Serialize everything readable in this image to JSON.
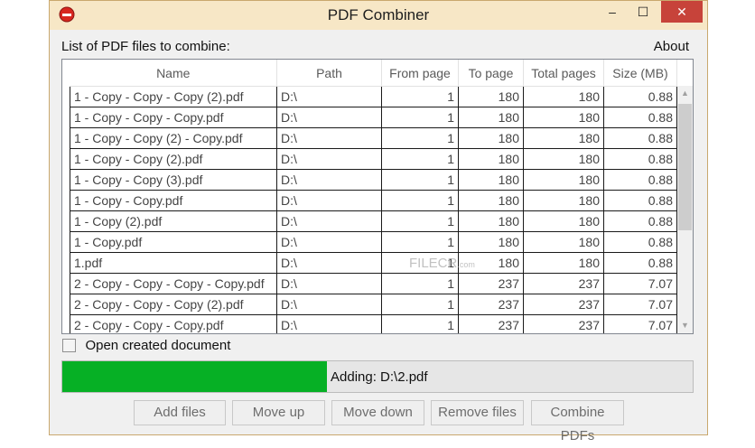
{
  "window": {
    "title": "PDF Combiner",
    "controls": {
      "minimize": "–",
      "maximize": "☐",
      "close": "✕"
    }
  },
  "list_label": "List of PDF files to combine:",
  "about_label": "About",
  "table": {
    "columns": [
      "Name",
      "Path",
      "From page",
      "To page",
      "Total pages",
      "Size (MB)"
    ],
    "rows": [
      [
        "1 - Copy - Copy - Copy (2).pdf",
        "D:\\",
        "1",
        "180",
        "180",
        "0.88"
      ],
      [
        "1 - Copy - Copy - Copy.pdf",
        "D:\\",
        "1",
        "180",
        "180",
        "0.88"
      ],
      [
        "1 - Copy - Copy (2) - Copy.pdf",
        "D:\\",
        "1",
        "180",
        "180",
        "0.88"
      ],
      [
        "1 - Copy - Copy (2).pdf",
        "D:\\",
        "1",
        "180",
        "180",
        "0.88"
      ],
      [
        "1 - Copy - Copy (3).pdf",
        "D:\\",
        "1",
        "180",
        "180",
        "0.88"
      ],
      [
        "1 - Copy - Copy.pdf",
        "D:\\",
        "1",
        "180",
        "180",
        "0.88"
      ],
      [
        "1 - Copy (2).pdf",
        "D:\\",
        "1",
        "180",
        "180",
        "0.88"
      ],
      [
        "1 - Copy.pdf",
        "D:\\",
        "1",
        "180",
        "180",
        "0.88"
      ],
      [
        "1.pdf",
        "D:\\",
        "1",
        "180",
        "180",
        "0.88"
      ],
      [
        "2 - Copy - Copy - Copy - Copy.pdf",
        "D:\\",
        "1",
        "237",
        "237",
        "7.07"
      ],
      [
        "2 - Copy - Copy - Copy (2).pdf",
        "D:\\",
        "1",
        "237",
        "237",
        "7.07"
      ],
      [
        "2 - Copy - Copy - Copy.pdf",
        "D:\\",
        "1",
        "237",
        "237",
        "7.07"
      ]
    ]
  },
  "open_created_document": {
    "label": "Open created document",
    "checked": false
  },
  "progress": {
    "percent": 42,
    "text": "Adding: D:\\2.pdf",
    "color": "#06b025"
  },
  "buttons": {
    "add_files": "Add files",
    "move_up": "Move up",
    "move_down": "Move down",
    "remove_files": "Remove files",
    "combine_pdfs": "Combine PDFs"
  },
  "watermark": "FILECR",
  "watermark_suffix": ".com"
}
